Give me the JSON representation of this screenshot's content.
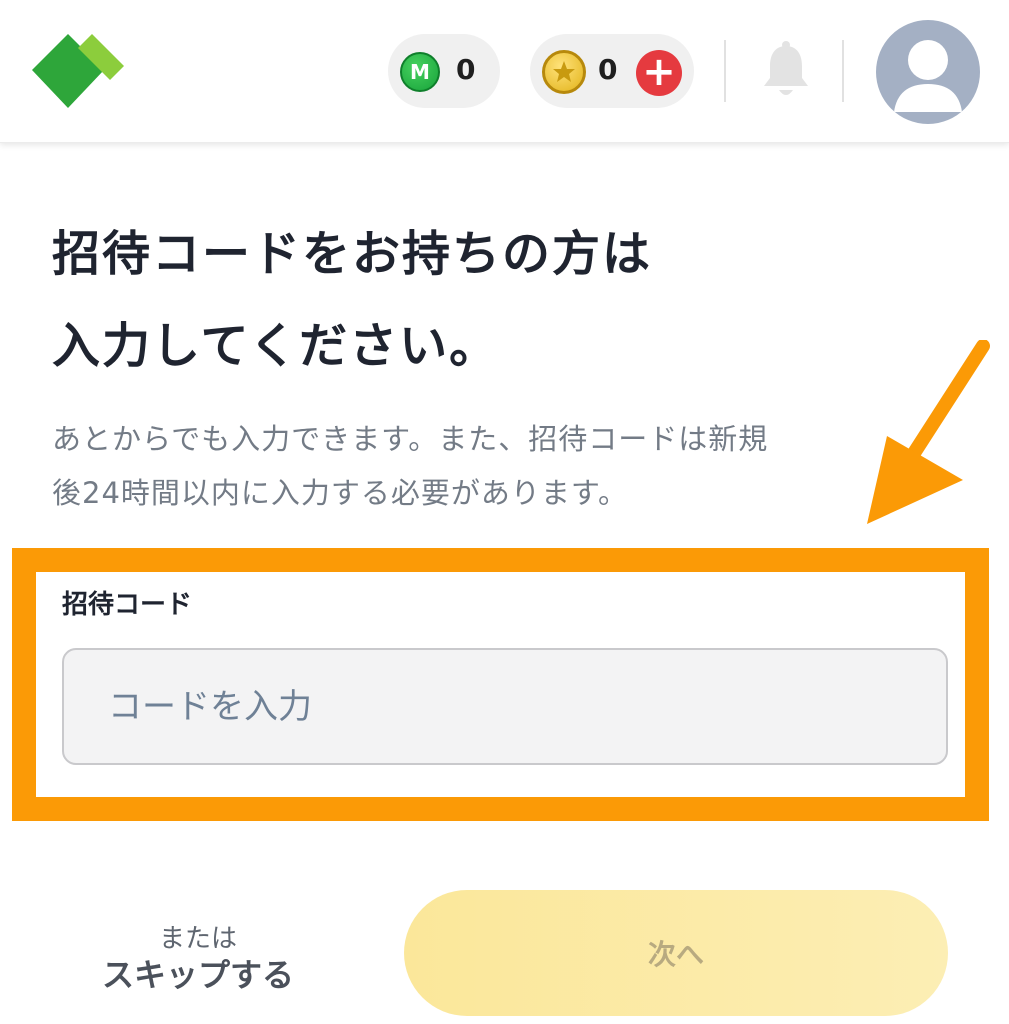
{
  "header": {
    "logo_icon": "wallet-logo-icon",
    "m_points": {
      "icon_letter": "M",
      "count": "0",
      "icon": "m-point-icon",
      "color": "#1fb543"
    },
    "coins": {
      "count": "0",
      "icon": "gold-coin-icon",
      "add_label": "+",
      "add_color": "#e53a3f"
    },
    "bell_icon": "bell-icon",
    "avatar_icon": "user-avatar-icon"
  },
  "main": {
    "title_line1": "招待コードをお持ちの方は",
    "title_line2": "入力してください。",
    "desc_line1": "あとからでも入力できます。また、招待コードは新規",
    "desc_line2": "後24時間以内に入力する必要があります。",
    "code_label": "招待コード",
    "code_placeholder": "コードを入力",
    "code_value": ""
  },
  "annotation": {
    "highlight_color": "#fb9a06",
    "arrow_icon": "orange-arrow-icon"
  },
  "footer": {
    "or_text": "または",
    "skip_label": "スキップする",
    "next_label": "次へ",
    "next_color": "#fbe79a"
  }
}
